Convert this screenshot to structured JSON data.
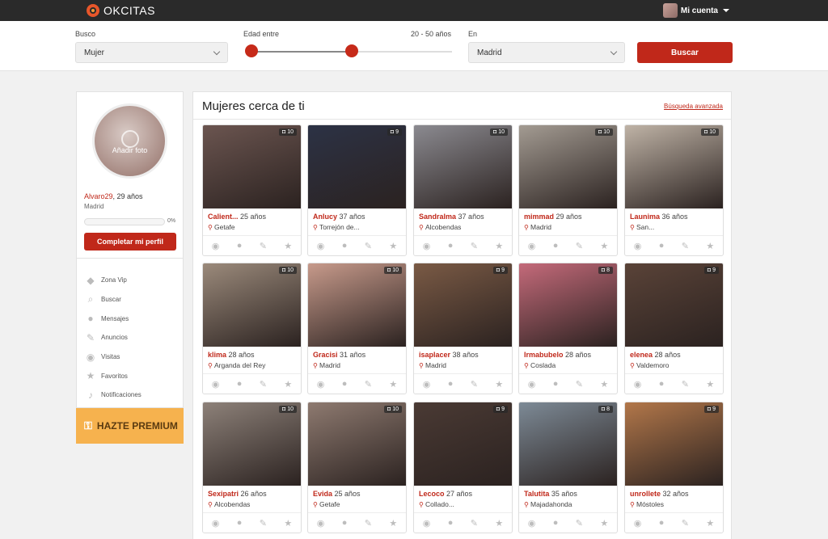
{
  "topbar": {
    "brand": "OKCITAS",
    "account_label": "Mi cuenta"
  },
  "search": {
    "busco_label": "Busco",
    "busco_value": "Mujer",
    "edad_label": "Edad entre",
    "edad_range": "20 - 50 años",
    "en_label": "En",
    "en_value": "Madrid",
    "button": "Buscar"
  },
  "profile": {
    "add_photo": "Añadir foto",
    "username": "Alvaro29",
    "age_text": ", 29 años",
    "city": "Madrid",
    "progress_pct_text": "0%",
    "progress_value": 0,
    "complete_button": "Completar mi perfil"
  },
  "menu": [
    {
      "icon": "diamond-icon",
      "label": "Zona Vip"
    },
    {
      "icon": "search-icon",
      "label": "Buscar"
    },
    {
      "icon": "chat-icon",
      "label": "Mensajes"
    },
    {
      "icon": "pin-icon",
      "label": "Anuncios"
    },
    {
      "icon": "eye-icon",
      "label": "Visitas"
    },
    {
      "icon": "star-icon",
      "label": "Favoritos"
    },
    {
      "icon": "bell-icon",
      "label": "Notificaciones"
    }
  ],
  "premium": "HAZTE PREMIUM",
  "main": {
    "title": "Mujeres cerca de ti",
    "advanced_link": "Búsqueda avanzada"
  },
  "cards": [
    {
      "name": "Calient...",
      "age": "25 años",
      "location": "Getafe",
      "photos": "10",
      "color": "#6b5550"
    },
    {
      "name": "Anlucy",
      "age": "37 años",
      "location": "Torrejón de...",
      "photos": "9",
      "color": "#2c3245"
    },
    {
      "name": "Sandralma",
      "age": "37 años",
      "location": "Alcobendas",
      "photos": "10",
      "color": "#8b8a90"
    },
    {
      "name": "mimmad",
      "age": "29 años",
      "location": "Madrid",
      "photos": "10",
      "color": "#a39b92"
    },
    {
      "name": "Launima",
      "age": "36 años",
      "location": "San...",
      "photos": "10",
      "color": "#bfb3a6"
    },
    {
      "name": "klima",
      "age": "28 años",
      "location": "Arganda del Rey",
      "photos": "10",
      "color": "#9b8a7b"
    },
    {
      "name": "Gracisi",
      "age": "31 años",
      "location": "Madrid",
      "photos": "10",
      "color": "#c79a8b"
    },
    {
      "name": "isaplacer",
      "age": "38 años",
      "location": "Madrid",
      "photos": "9",
      "color": "#7a5a45"
    },
    {
      "name": "Irmabubelo",
      "age": "28 años",
      "location": "Coslada",
      "photos": "8",
      "color": "#c46a7a"
    },
    {
      "name": "elenea",
      "age": "28 años",
      "location": "Valdemoro",
      "photos": "9",
      "color": "#5a4338"
    },
    {
      "name": "Sexipatri",
      "age": "26 años",
      "location": "Alcobendas",
      "photos": "10",
      "color": "#8d8179"
    },
    {
      "name": "Evida",
      "age": "25 años",
      "location": "Getafe",
      "photos": "10",
      "color": "#8e7a70"
    },
    {
      "name": "Lecoco",
      "age": "27 años",
      "location": "Collado...",
      "photos": "9",
      "color": "#4a3a34"
    },
    {
      "name": "Talutita",
      "age": "35 años",
      "location": "Majadahonda",
      "photos": "8",
      "color": "#7d8a96"
    },
    {
      "name": "unrollete",
      "age": "32 años",
      "location": "Móstoles",
      "photos": "9",
      "color": "#b2774a"
    }
  ]
}
